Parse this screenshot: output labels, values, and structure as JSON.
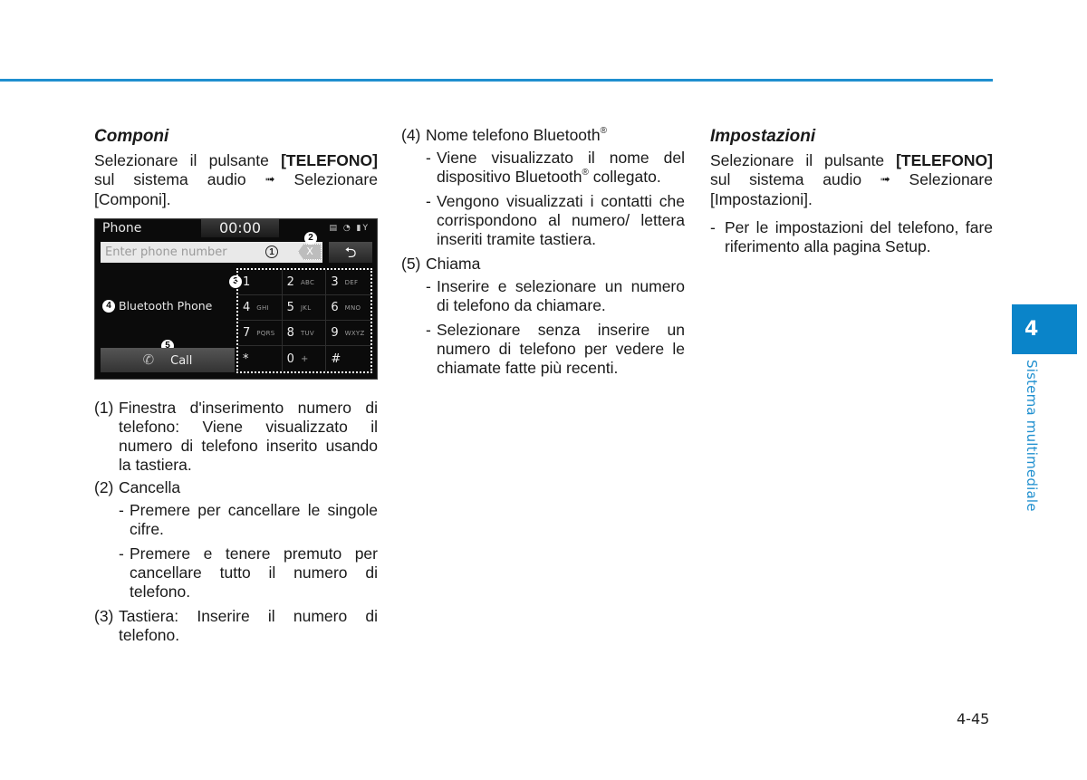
{
  "chapter": {
    "number": "4",
    "title": "Sistema multimediale",
    "accent_color": "#1f8fcf",
    "tab_color": "#0a84c9"
  },
  "page_number": "4-45",
  "componi": {
    "heading": "Componi",
    "intro_1": "Selezionare il pulsante ",
    "intro_bold": "[TELEFONO]",
    "intro_2": " sul sistema audio ",
    "arrow": "➟",
    "intro_3": " Selezionare [Componi]."
  },
  "screen": {
    "title": "Phone",
    "clock": "00:00",
    "status_icons": "▤ ◔ ▮Y",
    "input_placeholder": "Enter phone number",
    "clear_label": "X",
    "back_icon": "⮌",
    "bluetooth_name": "Bluetooth Phone",
    "call_label": "Call",
    "call_icon": "✆",
    "callouts": [
      "①",
      "2",
      "3",
      "4",
      "5"
    ],
    "keys": [
      {
        "digit": "1",
        "letters": ""
      },
      {
        "digit": "2",
        "letters": "ABC"
      },
      {
        "digit": "3",
        "letters": "DEF"
      },
      {
        "digit": "4",
        "letters": "GHI"
      },
      {
        "digit": "5",
        "letters": "JKL"
      },
      {
        "digit": "6",
        "letters": "MNO"
      },
      {
        "digit": "7",
        "letters": "PQRS"
      },
      {
        "digit": "8",
        "letters": "TUV"
      },
      {
        "digit": "9",
        "letters": "WXYZ"
      },
      {
        "digit": "*",
        "letters": ""
      },
      {
        "digit": "0",
        "letters": "+"
      },
      {
        "digit": "#",
        "letters": ""
      }
    ]
  },
  "items": {
    "i1": {
      "num": "(1)",
      "text": "Finestra d'inserimento numero di telefono: Viene visualizzato il numero di telefono inserito usando la tastiera."
    },
    "i2": {
      "num": "(2)",
      "text": "Cancella",
      "subs": [
        "Premere per cancellare le singole cifre.",
        "Premere e tenere premuto per cancellare tutto il numero di telefono."
      ]
    },
    "i3": {
      "num": "(3)",
      "text": "Tastiera: Inserire il numero di telefono."
    },
    "i4": {
      "num": "(4)",
      "text": "Nome telefono Bluetooth",
      "reg": "®",
      "sub1_a": "Viene visualizzato il nome del dispositivo Bluetooth",
      "sub1_b": " collegato.",
      "sub2": "Vengono visualizzati i contatti che corrispondono al numero/ lettera inseriti tramite tastiera."
    },
    "i5": {
      "num": "(5)",
      "text": "Chiama",
      "subs": [
        "Inserire e selezionare un numero di telefono da chiamare.",
        "Selezionare senza inserire un numero di telefono per vedere le chiamate fatte più recenti."
      ]
    }
  },
  "impostazioni": {
    "heading": "Impostazioni",
    "intro_1": "Selezionare il pulsante ",
    "intro_bold": "[TELEFONO]",
    "intro_2": " sul sistema audio ",
    "arrow": "➟",
    "intro_3": " Selezionare [Impostazioni].",
    "sub": "Per le impostazioni del telefono, fare riferimento alla pagina Setup."
  },
  "dash": "-"
}
